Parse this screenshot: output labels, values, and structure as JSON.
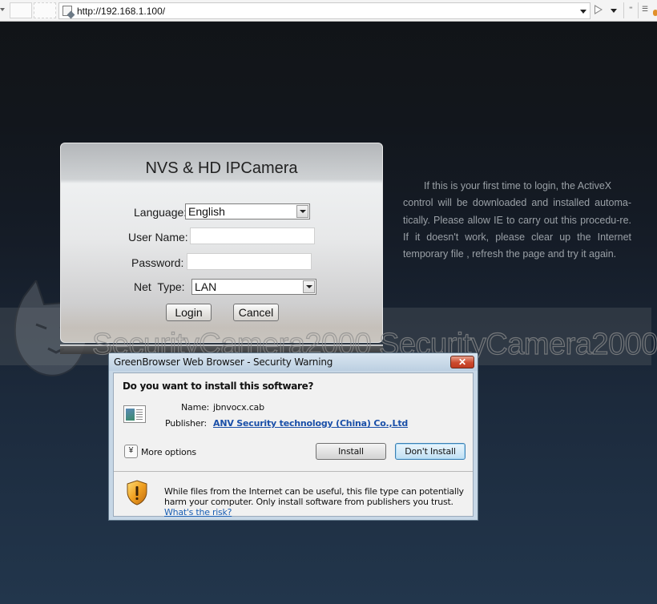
{
  "browser": {
    "url": "http://192.168.1.100/"
  },
  "login": {
    "title": "NVS & HD IPCamera",
    "language_label": "Language:",
    "language_value": "English",
    "username_label": "User Name:",
    "username_value": "",
    "password_label": "Password:",
    "password_value": "",
    "nettype_label": "Net  Type:",
    "nettype_value": "LAN",
    "login_button": "Login",
    "cancel_button": "Cancel"
  },
  "info": {
    "line1": "If this is your first time to login, the ActiveX",
    "rest": "control will be downloaded and installed automa-tically. Please allow IE to carry out this procedu-re. If it doesn't work, please clear up the Internet temporary file , refresh the page and try it again."
  },
  "watermark": {
    "text": "SecurityCamera2000 SecurityCamera2000"
  },
  "dialog": {
    "title": "GreenBrowser Web Browser - Security Warning",
    "close_label": "✕",
    "question": "Do you want to install this software?",
    "name_label": "Name:",
    "name_value": "jbnvocx.cab",
    "publisher_label": "Publisher:",
    "publisher_value": "ANV Security technology (China) Co.,Ltd",
    "more_options": "More options",
    "install_button": "Install",
    "dont_install_button": "Don't Install",
    "warning_text": "While files from the Internet can be useful, this file type can potentially harm your computer. Only install software from publishers you trust.",
    "risk_link": "What's the risk?"
  }
}
